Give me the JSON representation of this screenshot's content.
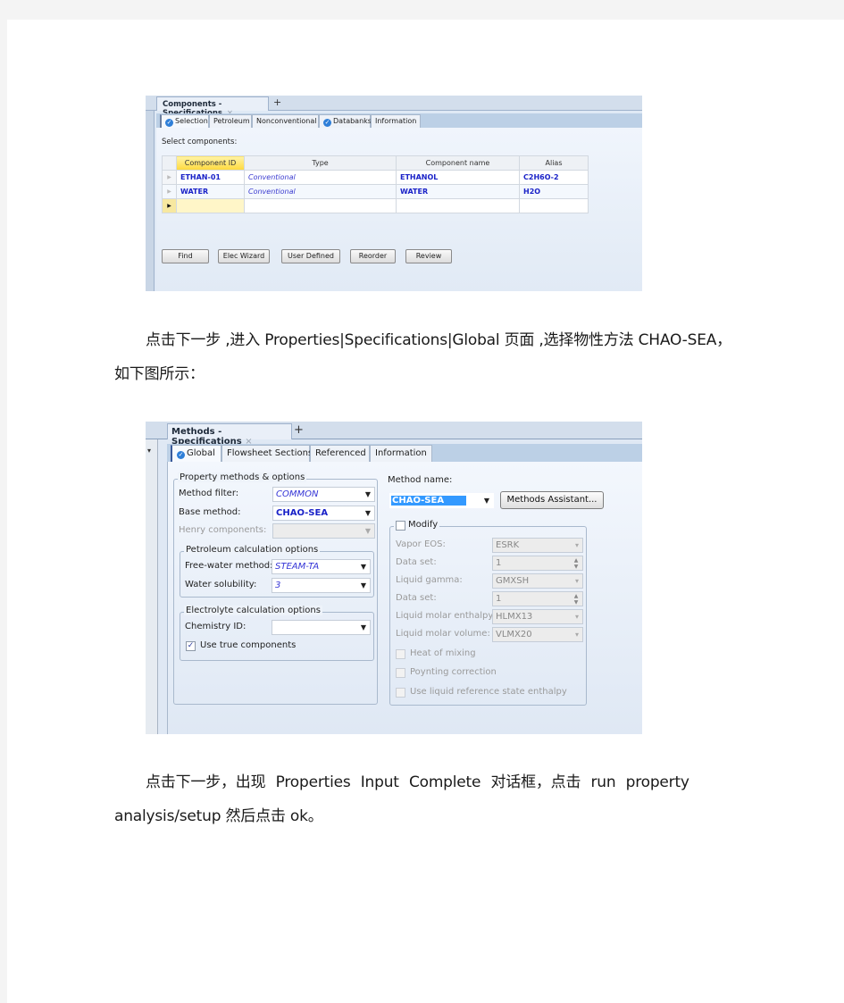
{
  "screenshot_components": {
    "doc_tab": "Components - Specifications",
    "close_glyph": "×",
    "add_glyph": "+",
    "tabs": [
      {
        "label": "Selection",
        "icon": "check-circle-icon",
        "active": true
      },
      {
        "label": "Petroleum"
      },
      {
        "label": "Nonconventional"
      },
      {
        "label": "Databanks",
        "icon": "check-circle-icon"
      },
      {
        "label": "Information"
      }
    ],
    "select_label": "Select components:",
    "table": {
      "headers": [
        "Component ID",
        "Type",
        "Component name",
        "Alias"
      ],
      "rows": [
        [
          "ETHAN-01",
          "Conventional",
          "ETHANOL",
          "C2H6O-2"
        ],
        [
          "WATER",
          "Conventional",
          "WATER",
          "H2O"
        ],
        [
          "",
          "",
          "",
          ""
        ]
      ]
    },
    "buttons": [
      "Find",
      "Elec Wizard",
      "User Defined",
      "Reorder",
      "Review"
    ]
  },
  "paragraph1": {
    "line1": "点击下一步 ,进入 Properties|Specifications|Global 页面 ,选择物性方法 CHAO-SEA，",
    "line2": "如下图所示："
  },
  "screenshot_methods": {
    "doc_tab": "Methods - Specifications",
    "close_glyph": "×",
    "add_glyph": "+",
    "tabs": [
      {
        "label": "Global",
        "icon": "check-circle-icon",
        "active": true
      },
      {
        "label": "Flowsheet Sections"
      },
      {
        "label": "Referenced"
      },
      {
        "label": "Information"
      }
    ],
    "property_group": {
      "title": "Property methods & options",
      "method_filter_label": "Method filter:",
      "method_filter_value": "COMMON",
      "base_method_label": "Base method:",
      "base_method_value": "CHAO-SEA",
      "henry_label": "Henry components:",
      "henry_value": ""
    },
    "petroleum_group": {
      "title": "Petroleum calculation options",
      "free_water_label": "Free-water method:",
      "free_water_value": "STEAM-TA",
      "water_solubility_label": "Water solubility:",
      "water_solubility_value": "3"
    },
    "electrolyte_group": {
      "title": "Electrolyte calculation options",
      "chemistry_label": "Chemistry ID:",
      "chemistry_value": "",
      "use_true_label": "Use true components",
      "use_true_checked": true
    },
    "method_name_label": "Method name:",
    "method_name_value": "CHAO-SEA",
    "methods_assistant": "Methods Assistant...",
    "modify": {
      "label": "Modify",
      "checked": false,
      "fields": [
        {
          "label": "Vapor EOS:",
          "value": "ESRK",
          "kind": "dropdown"
        },
        {
          "label": "Data set:",
          "value": "1",
          "kind": "spinner"
        },
        {
          "label": "Liquid gamma:",
          "value": "GMXSH",
          "kind": "dropdown"
        },
        {
          "label": "Data set:",
          "value": "1",
          "kind": "spinner"
        },
        {
          "label": "Liquid molar enthalpy:",
          "value": "HLMX13",
          "kind": "dropdown"
        },
        {
          "label": "Liquid molar volume:",
          "value": "VLMX20",
          "kind": "dropdown"
        }
      ],
      "checkboxes": [
        "Heat of mixing",
        "Poynting correction",
        "Use liquid reference state enthalpy"
      ]
    }
  },
  "paragraph2": {
    "line1": "点击下一步，出现  Properties  Input  Complete  对话框，点击  run  property",
    "line2": "analysis/setup 然后点击 ok。"
  }
}
